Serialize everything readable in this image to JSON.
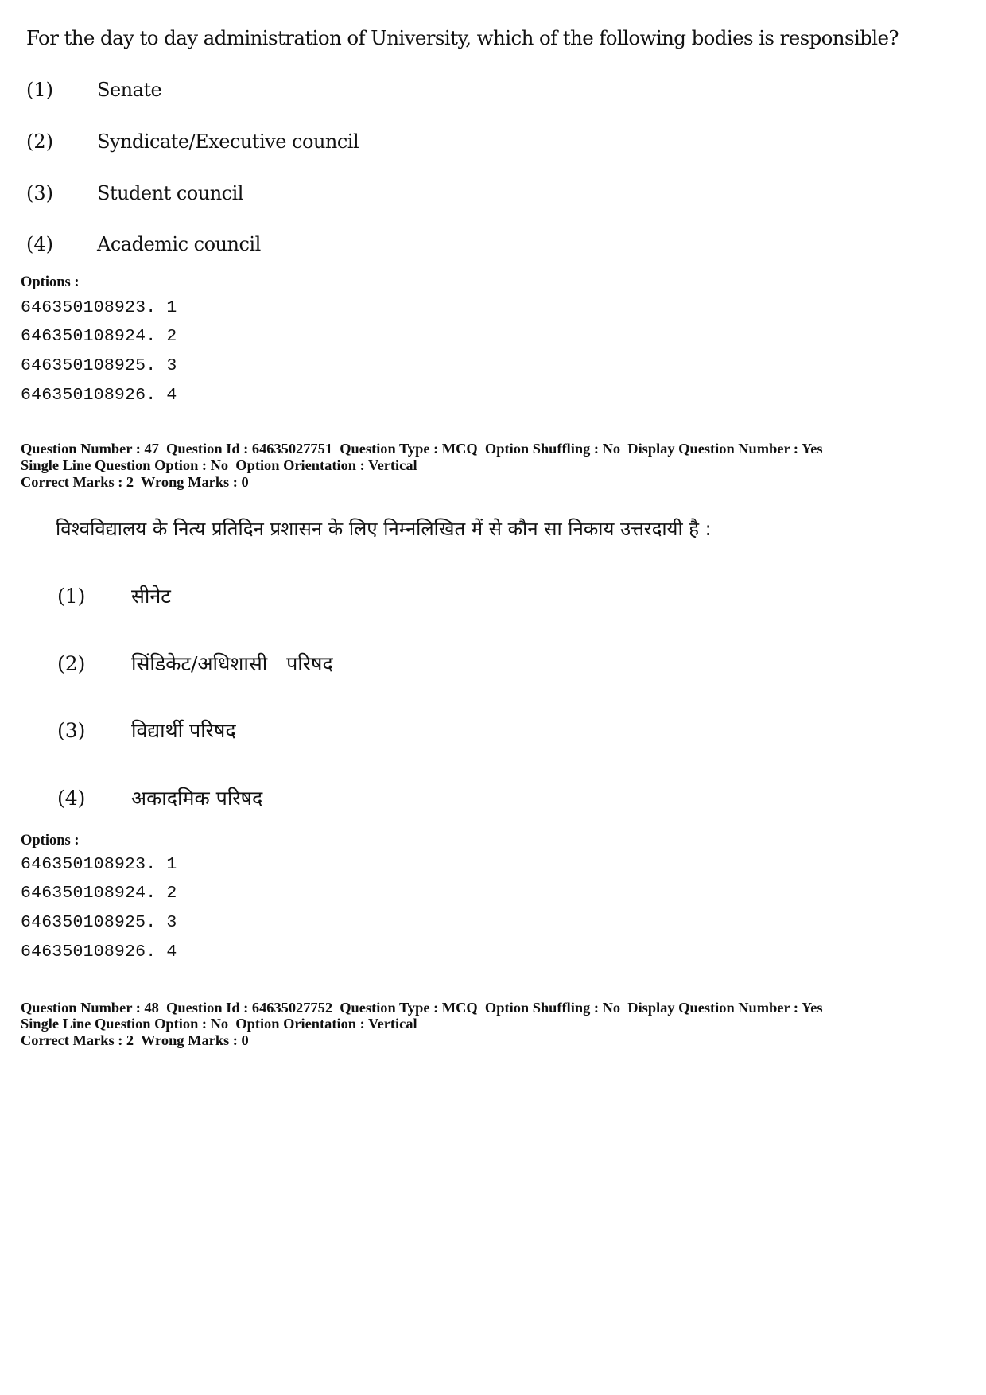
{
  "question_46_tail": {
    "english": {
      "question_text": "For the day to day administration of University, which of the following bodies is responsible?",
      "choices": [
        {
          "number": "(1)",
          "text": "Senate"
        },
        {
          "number": "(2)",
          "text": "Syndicate/Executive council"
        },
        {
          "number": "(3)",
          "text": "Student council"
        },
        {
          "number": "(4)",
          "text": "Academic council"
        }
      ]
    },
    "options_label": "Options :",
    "option_ids": [
      "646350108923. 1",
      "646350108924. 2",
      "646350108925. 3",
      "646350108926. 4"
    ]
  },
  "question_47": {
    "meta": {
      "line1": "Question Number : 47  Question Id : 64635027751  Question Type : MCQ  Option Shuffling : No  Display Question Number : Yes",
      "line2": "Single Line Question Option : No  Option Orientation : Vertical",
      "line3": "Correct Marks : 2  Wrong Marks : 0"
    },
    "hindi": {
      "question_text": "विश्वविद्यालय के नित्य प्रतिदिन प्रशासन के लिए निम्नलिखित में से कौन सा निकाय उत्तरदायी है :",
      "choices": [
        {
          "number": "(1)",
          "text": "सीनेट"
        },
        {
          "number": "(2)",
          "text": "सिंडिकेट/अधिशासी   परिषद"
        },
        {
          "number": "(3)",
          "text": "विद्यार्थी परिषद"
        },
        {
          "number": "(4)",
          "text": "अकादमिक परिषद"
        }
      ]
    },
    "options_label": "Options :",
    "option_ids": [
      "646350108923. 1",
      "646350108924. 2",
      "646350108925. 3",
      "646350108926. 4"
    ]
  },
  "question_48": {
    "meta": {
      "line1": "Question Number : 48  Question Id : 64635027752  Question Type : MCQ  Option Shuffling : No  Display Question Number : Yes",
      "line2": "Single Line Question Option : No  Option Orientation : Vertical",
      "line3": "Correct Marks : 2  Wrong Marks : 0"
    }
  }
}
